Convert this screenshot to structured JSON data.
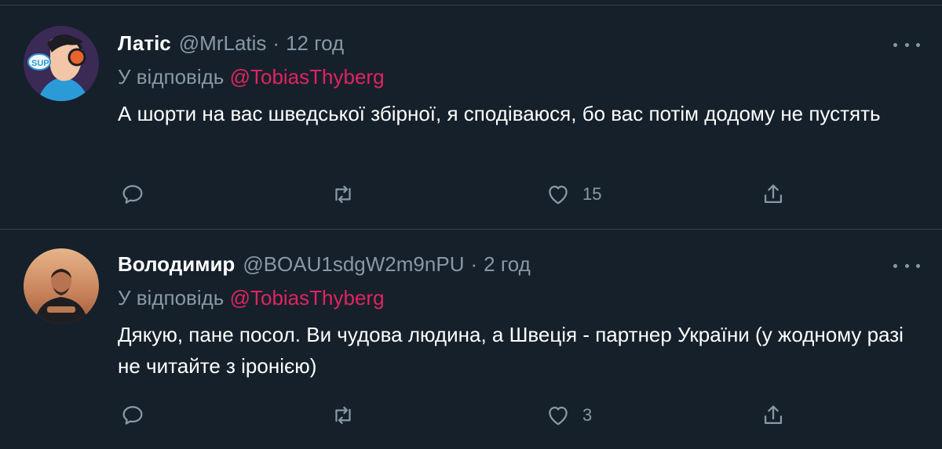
{
  "colors": {
    "background": "#15202b",
    "divider": "#38444d",
    "secondary_text": "#8899a6",
    "mention": "#e0245e"
  },
  "tweets": [
    {
      "display_name": "Латіс",
      "handle": "@MrLatis",
      "separator": "·",
      "time": "12 год",
      "reply_prefix": "У відповідь",
      "reply_to": "@TobiasThyberg",
      "text": "А шорти на вас шведської збірної, я сподіваюся, бо вас потім додому не пустять",
      "like_count": "15",
      "avatar_icon": "cartoon-headphones-avatar",
      "avatar_badge_text": "SUP"
    },
    {
      "display_name": "Володимир",
      "handle": "@BOAU1sdgW2m9nPU",
      "separator": "·",
      "time": "2 год",
      "reply_prefix": "У відповідь",
      "reply_to": "@TobiasThyberg",
      "text": "Дякую, пане посол. Ви чудова людина, а Швеція - партнер України (у жодному разі не читайте з іронією)",
      "like_count": "3",
      "avatar_icon": "photo-man-avatar"
    }
  ],
  "icons": [
    "reply-icon",
    "retweet-icon",
    "like-icon",
    "share-icon",
    "more-icon"
  ]
}
